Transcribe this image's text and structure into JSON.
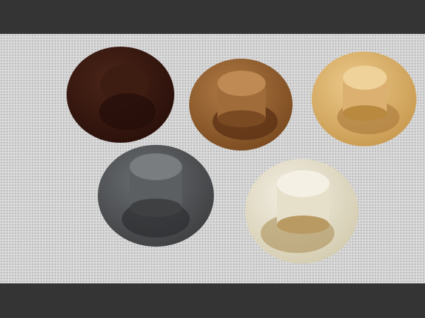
{
  "image": {
    "subject": "",
    "background_color": "#d9d9d9",
    "frame_color": "#333333",
    "caps": [
      {
        "name": "dark-brown-cap",
        "color": "#3a1a12",
        "shade": "#2a100a",
        "highlight": "#4a2418"
      },
      {
        "name": "medium-brown-cap",
        "color": "#9a6230",
        "shade": "#6e3f18",
        "highlight": "#b07a44"
      },
      {
        "name": "tan-cap",
        "color": "#d9ac62",
        "shade": "#b58a44",
        "highlight": "#e6c27e"
      },
      {
        "name": "grey-cap",
        "color": "#55585b",
        "shade": "#3c3e40",
        "highlight": "#6e7174"
      },
      {
        "name": "beige-cap",
        "color": "#e2dcc4",
        "shade": "#b59a66",
        "highlight": "#efeadb"
      }
    ]
  }
}
